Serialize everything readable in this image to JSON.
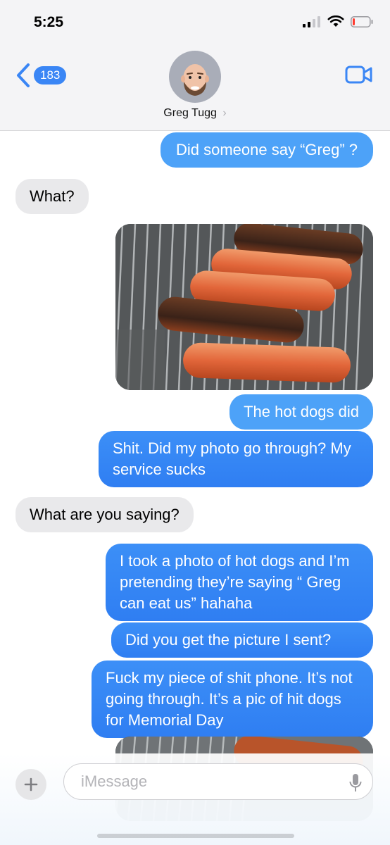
{
  "status_bar": {
    "time": "5:25"
  },
  "header": {
    "back_count": "183",
    "contact_name": "Greg Tugg",
    "chevron": "›"
  },
  "messages": [
    {
      "side": "sent",
      "text": "Did someone say “Greg” ?"
    },
    {
      "side": "received",
      "text": "What?"
    },
    {
      "side": "sent",
      "type": "photo",
      "description": "hot-dogs-photo"
    },
    {
      "side": "sent",
      "text": "The hot dogs did"
    },
    {
      "side": "sent",
      "text": "Shit. Did my photo go through? My service sucks"
    },
    {
      "side": "received",
      "text": "What are you saying?"
    },
    {
      "side": "sent",
      "text": "I took a photo of hot dogs and I’m pretending they’re saying “ Greg can eat us” hahaha"
    },
    {
      "side": "sent",
      "text": "Did you get the picture I sent?"
    },
    {
      "side": "sent",
      "text": "Fuck my piece of shit phone. It’s not going through. It’s a pic of hit dogs for Memorial Day"
    },
    {
      "side": "sent",
      "type": "photo",
      "description": "hot-dogs-photo-partial"
    }
  ],
  "input": {
    "placeholder": "iMessage"
  },
  "colors": {
    "sent_bubble": "#3a86f5",
    "received_bubble": "#e9e9eb",
    "accent": "#3a86f5"
  },
  "icons": [
    "back-chevron-icon",
    "video-camera-icon",
    "plus-icon",
    "microphone-icon",
    "signal-icon",
    "wifi-icon",
    "battery-icon"
  ]
}
